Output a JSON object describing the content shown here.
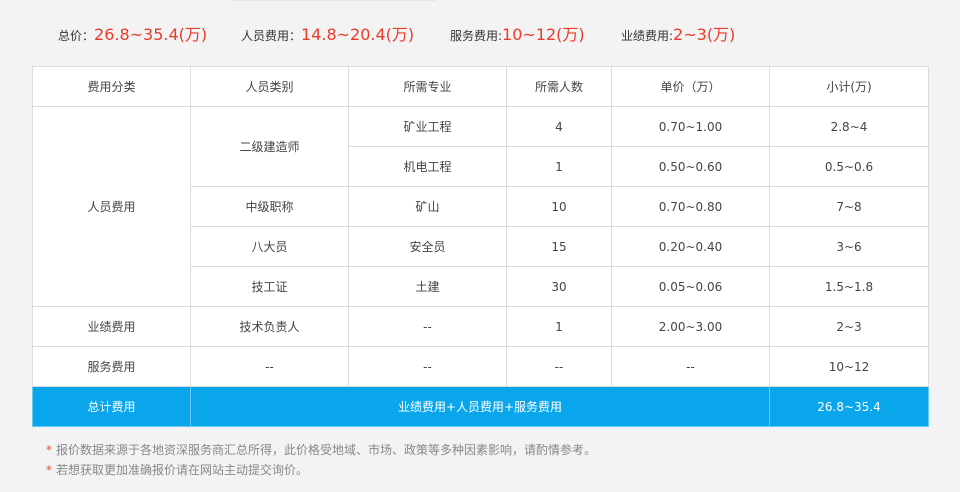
{
  "summary": {
    "total_label": "总价：",
    "total_value": "26.8~35.4(万)",
    "person_label": "人员费用：",
    "person_value": "14.8~20.4(万)",
    "service_label": "服务费用:",
    "service_value": "10~12(万)",
    "perf_label": "业绩费用:",
    "perf_value": "2~3(万)"
  },
  "table": {
    "headers": [
      "费用分类",
      "人员类别",
      "所需专业",
      "所需人数",
      "单价（万）",
      "小计(万)"
    ],
    "person_category": "人员费用",
    "rows": [
      {
        "type": "二级建造师",
        "major": "矿业工程",
        "count": "4",
        "price": "0.70~1.00",
        "subtotal": "2.8~4"
      },
      {
        "major": "机电工程",
        "count": "1",
        "price": "0.50~0.60",
        "subtotal": "0.5~0.6"
      },
      {
        "type": "中级职称",
        "major": "矿山",
        "count": "10",
        "price": "0.70~0.80",
        "subtotal": "7~8"
      },
      {
        "type": "八大员",
        "major": "安全员",
        "count": "15",
        "price": "0.20~0.40",
        "subtotal": "3~6"
      },
      {
        "type": "技工证",
        "major": "土建",
        "count": "30",
        "price": "0.05~0.06",
        "subtotal": "1.5~1.8"
      }
    ],
    "perf_row": {
      "category": "业绩费用",
      "type": "技术负责人",
      "major": "--",
      "count": "1",
      "price": "2.00~3.00",
      "subtotal": "2~3"
    },
    "service_row": {
      "category": "服务费用",
      "type": "--",
      "major": "--",
      "count": "--",
      "price": "--",
      "subtotal": "10~12"
    },
    "total_row": {
      "category": "总计费用",
      "formula": "业绩费用+人员费用+服务费用",
      "subtotal": "26.8~35.4"
    }
  },
  "notes": {
    "star": "*",
    "note1": "报价数据来源于各地资深服务商汇总所得，此价格受地域、市场、政策等多种因素影响，请酌情参考。",
    "note2": "若想获取更加准确报价请在网站主动提交询价。"
  },
  "colors": {
    "accent_red": "#ea3b2a",
    "total_row_bg": "#0aa6ec"
  }
}
